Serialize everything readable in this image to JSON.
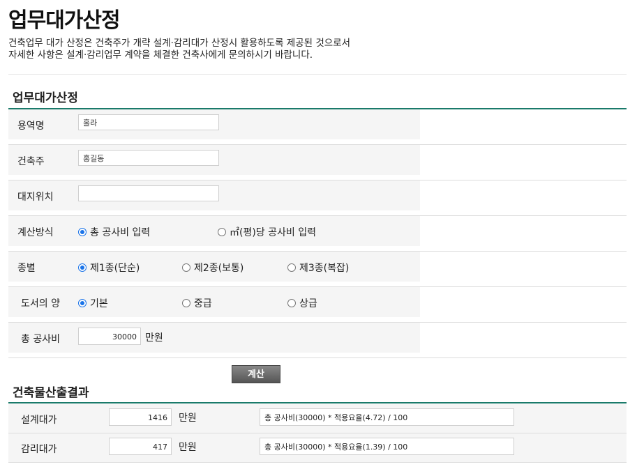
{
  "page": {
    "title": "업무대가산정",
    "intro_line1": "건축업무 대가 산정은 건축주가 개략 설계·감리대가 산정시 활용하도록 제공된 것으로서",
    "intro_line2": "자세한 사항은 설계·감리업무 계약을 체결한 건축사에게 문의하시기 바랍니다."
  },
  "form": {
    "section_title": "업무대가산정",
    "project_name": {
      "label": "용역명",
      "value": "홀라"
    },
    "client": {
      "label": "건축주",
      "value": "홍길동"
    },
    "site": {
      "label": "대지위치",
      "value": ""
    },
    "calc_method": {
      "label": "계산방식",
      "opt1": "총 공사비 입력",
      "opt2": "㎡(평)당 공사비 입력",
      "selected": 1
    },
    "category": {
      "label": "종별",
      "opt1": "제1종(단순)",
      "opt2": "제2종(보통)",
      "opt3": "제3종(복잡)",
      "selected": 1
    },
    "drawings": {
      "label": "도서의 양",
      "opt1": "기본",
      "opt2": "중급",
      "opt3": "상급",
      "selected": 1
    },
    "total_cost": {
      "label": "총 공사비",
      "value": "30000",
      "unit": "만원"
    },
    "calc_button": "계산"
  },
  "result": {
    "section_title": "건축물산출결과",
    "design": {
      "label": "설계대가",
      "value": "1416",
      "unit": "만원",
      "formula": "총 공사비(30000) * 적용요율(4.72) / 100"
    },
    "supervision": {
      "label": "감리대가",
      "value": "417",
      "unit": "만원",
      "formula": "총 공사비(30000) * 적용요율(1.39) / 100"
    }
  },
  "colors": {
    "accent": "#1a7a6a",
    "radio": "#1a73e8"
  }
}
